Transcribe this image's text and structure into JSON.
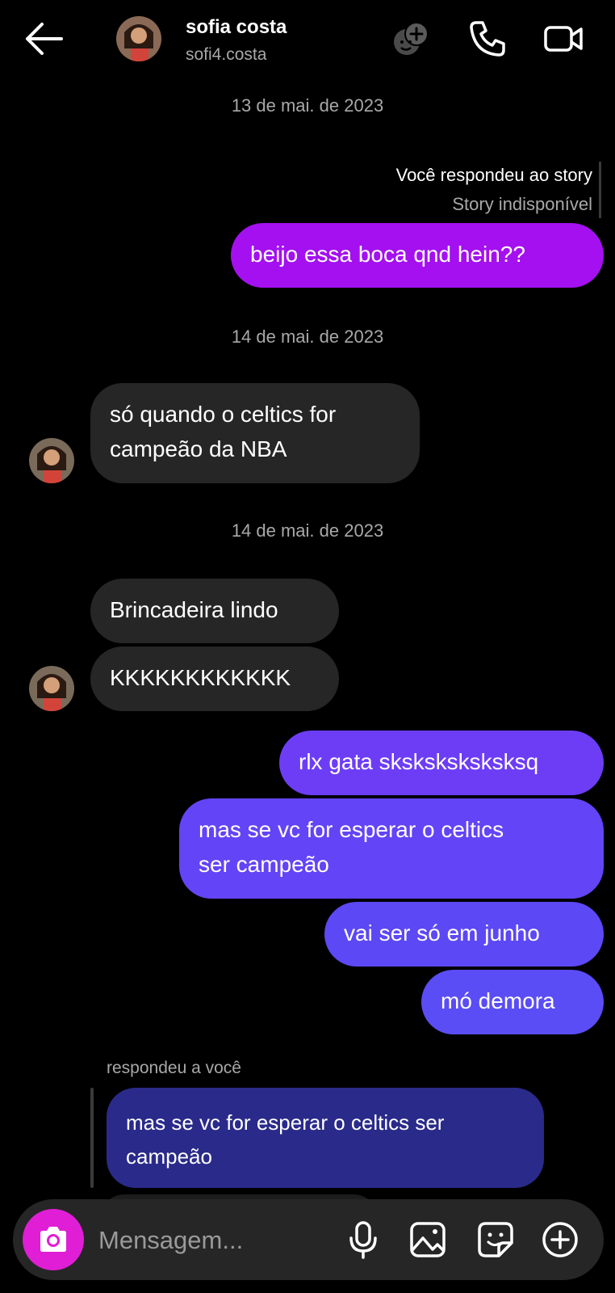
{
  "header": {
    "name": "sofia costa",
    "username": "sofi4.costa",
    "icons": [
      "back-arrow-icon",
      "effects-icon",
      "phone-icon",
      "video-icon"
    ]
  },
  "thread": {
    "date1": "13 de mai. de 2023",
    "story_reply_label": "Você respondeu ao story",
    "story_unavailable": "Story indisponível",
    "msg1": "beijo essa boca qnd hein??",
    "date2": "14 de mai. de 2023",
    "msg2_line1": "só quando o celtics for",
    "msg2_line2": "campeão da NBA",
    "date3": "14 de mai. de 2023",
    "msg3": "Brincadeira lindo",
    "msg4": "KKKKKKKKKKKK",
    "msg5": "rlx gata sksksksksksksq",
    "msg6_line1": "mas se vc for esperar o celtics",
    "msg6_line2": "ser campeão",
    "msg7": "vai ser só em junho",
    "msg8": "mó demora",
    "quote_label": "respondeu a você",
    "quote_line1": "mas se vc for esperar o celtics ser",
    "quote_line2": "campeão"
  },
  "composer": {
    "placeholder": "Mensagem...",
    "icons": [
      "camera-icon",
      "microphone-icon",
      "gallery-icon",
      "sticker-icon",
      "plus-icon"
    ]
  },
  "colors": {
    "background": "#000000",
    "incoming": "#262626",
    "outgoing_top": "#a410f0",
    "outgoing_mid": "#6a3cf6",
    "outgoing_bottom": "#5a4df5",
    "quote": "#2a2a8a",
    "camera_button": "#e01ed6"
  }
}
